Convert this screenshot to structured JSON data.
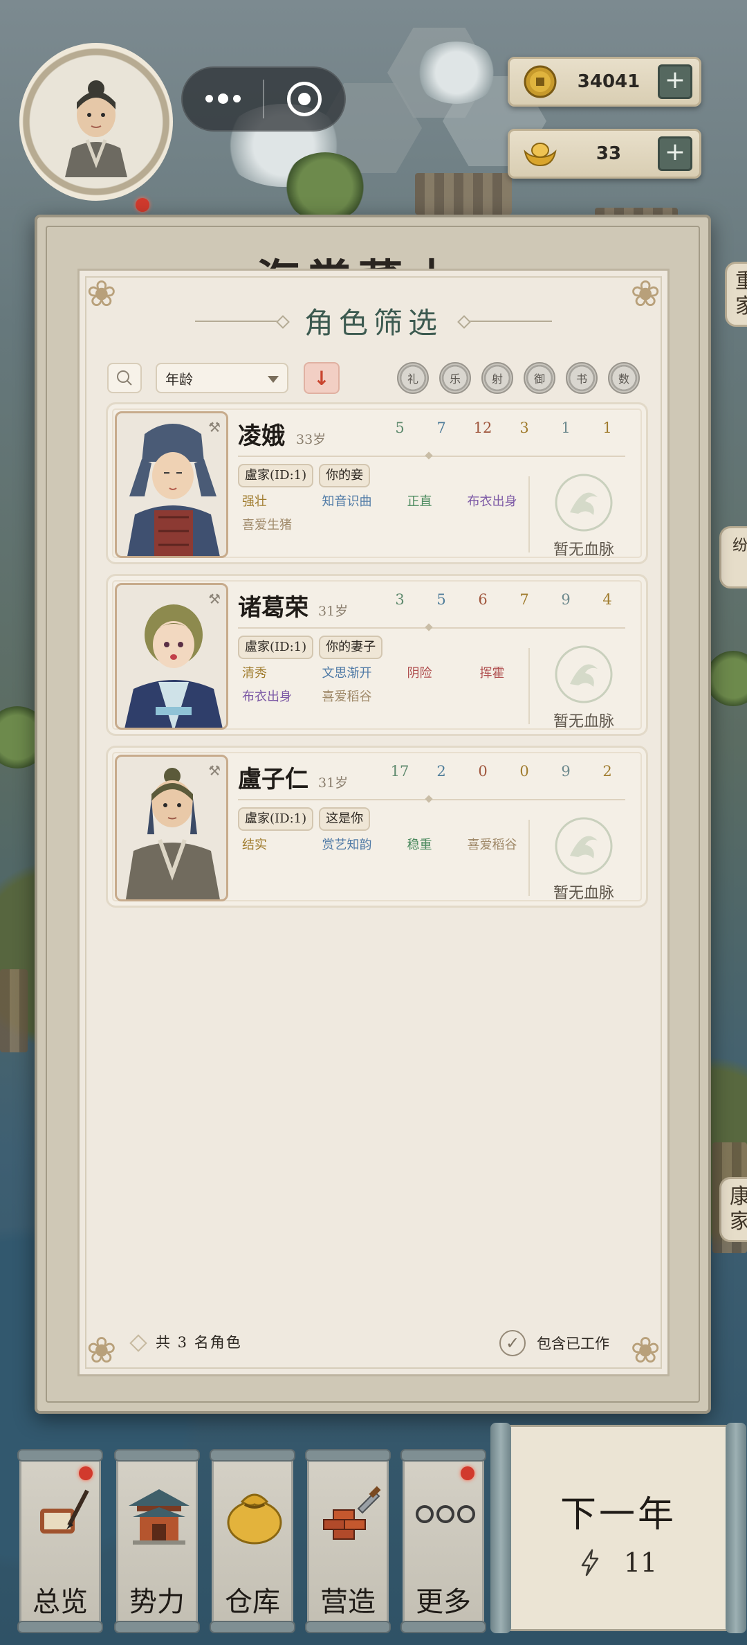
{
  "hud": {
    "coins": "34041",
    "ingots": "33",
    "plus": "+",
    "side_tab_top": "重家",
    "side_tab_bottom": "康家",
    "side_tab_mid": "纷",
    "ghost_title": "海棠蕃木"
  },
  "panel": {
    "title": "角色筛选",
    "sort_label": "年龄",
    "sort_dir_icon": "arrow-down-icon",
    "attributes": [
      "礼",
      "乐",
      "射",
      "御",
      "书",
      "数"
    ],
    "footer_count": "共 3 名角色",
    "include_working_label": "包含已工作",
    "include_working_checked": true
  },
  "characters": [
    {
      "name": "凌娥",
      "age": "33岁",
      "stats": [
        "5",
        "7",
        "12",
        "3",
        "1",
        "1"
      ],
      "family_tag": "盧家(ID:1)",
      "relation_tag": "你的妾",
      "traits": [
        {
          "text": "强壮",
          "color": "#a07c2e"
        },
        {
          "text": "知音识曲",
          "color": "#4f7aa6"
        },
        {
          "text": "正直",
          "color": "#4b8a5e"
        },
        {
          "text": "布衣出身",
          "color": "#7d5aa6"
        },
        {
          "text": "喜爱生猪",
          "color": "#a08a6a"
        }
      ],
      "bloodline": "暂无血脉"
    },
    {
      "name": "诸葛荣",
      "age": "31岁",
      "stats": [
        "3",
        "5",
        "6",
        "7",
        "9",
        "4"
      ],
      "family_tag": "盧家(ID:1)",
      "relation_tag": "你的妻子",
      "traits": [
        {
          "text": "清秀",
          "color": "#a07c2e"
        },
        {
          "text": "文思渐开",
          "color": "#4f7aa6"
        },
        {
          "text": "阴险",
          "color": "#b05050"
        },
        {
          "text": "挥霍",
          "color": "#b05050"
        },
        {
          "text": "布衣出身",
          "color": "#7d5aa6"
        },
        {
          "text": "喜爱稻谷",
          "color": "#a08a6a"
        }
      ],
      "bloodline": "暂无血脉"
    },
    {
      "name": "盧子仁",
      "age": "31岁",
      "stats": [
        "17",
        "2",
        "0",
        "0",
        "9",
        "2"
      ],
      "family_tag": "盧家(ID:1)",
      "relation_tag": "这是你",
      "traits": [
        {
          "text": "结实",
          "color": "#a07c2e"
        },
        {
          "text": "赏艺知韵",
          "color": "#4f7aa6"
        },
        {
          "text": "稳重",
          "color": "#4b8a5e"
        },
        {
          "text": "喜爱稻谷",
          "color": "#a08a6a"
        }
      ],
      "bloodline": "暂无血脉"
    }
  ],
  "stat_colors": [
    "#5f8a6e",
    "#4f7d9a",
    "#a0573e",
    "#a07c2e",
    "#6e8a8e",
    "#a07c2e"
  ],
  "nav": [
    {
      "label": "总览",
      "icon": "scroll-brush-icon",
      "badge": true
    },
    {
      "label": "势力",
      "icon": "pavilion-icon",
      "badge": false
    },
    {
      "label": "仓库",
      "icon": "money-bag-icon",
      "badge": false
    },
    {
      "label": "营造",
      "icon": "bricks-trowel-icon",
      "badge": false
    },
    {
      "label": "更多",
      "icon": "more-icon",
      "badge": true
    }
  ],
  "next_year": {
    "label": "下一年",
    "energy": "11",
    "energy_icon": "lightning-icon"
  }
}
